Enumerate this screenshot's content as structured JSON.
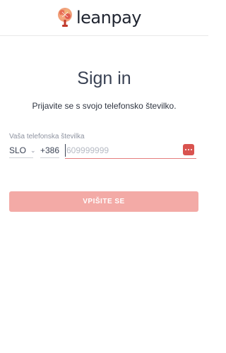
{
  "header": {
    "logo_text": "leanpay",
    "logo_icon": "tree-logo-icon"
  },
  "main": {
    "title": "Sign in",
    "subtitle": "Prijavite se s svojo telefonsko številko."
  },
  "form": {
    "phone_label": "Vaša telefonska številka",
    "country_value": "SLO",
    "dial_code": "+386",
    "phone_value": "",
    "phone_placeholder": "609999999",
    "keyboard_icon": "keyboard-icon",
    "submit_label": "VPIŠITE SE"
  },
  "colors": {
    "accent": "#d9534f",
    "button_disabled": "#f3aaa6",
    "error_underline": "#e57e7e"
  }
}
